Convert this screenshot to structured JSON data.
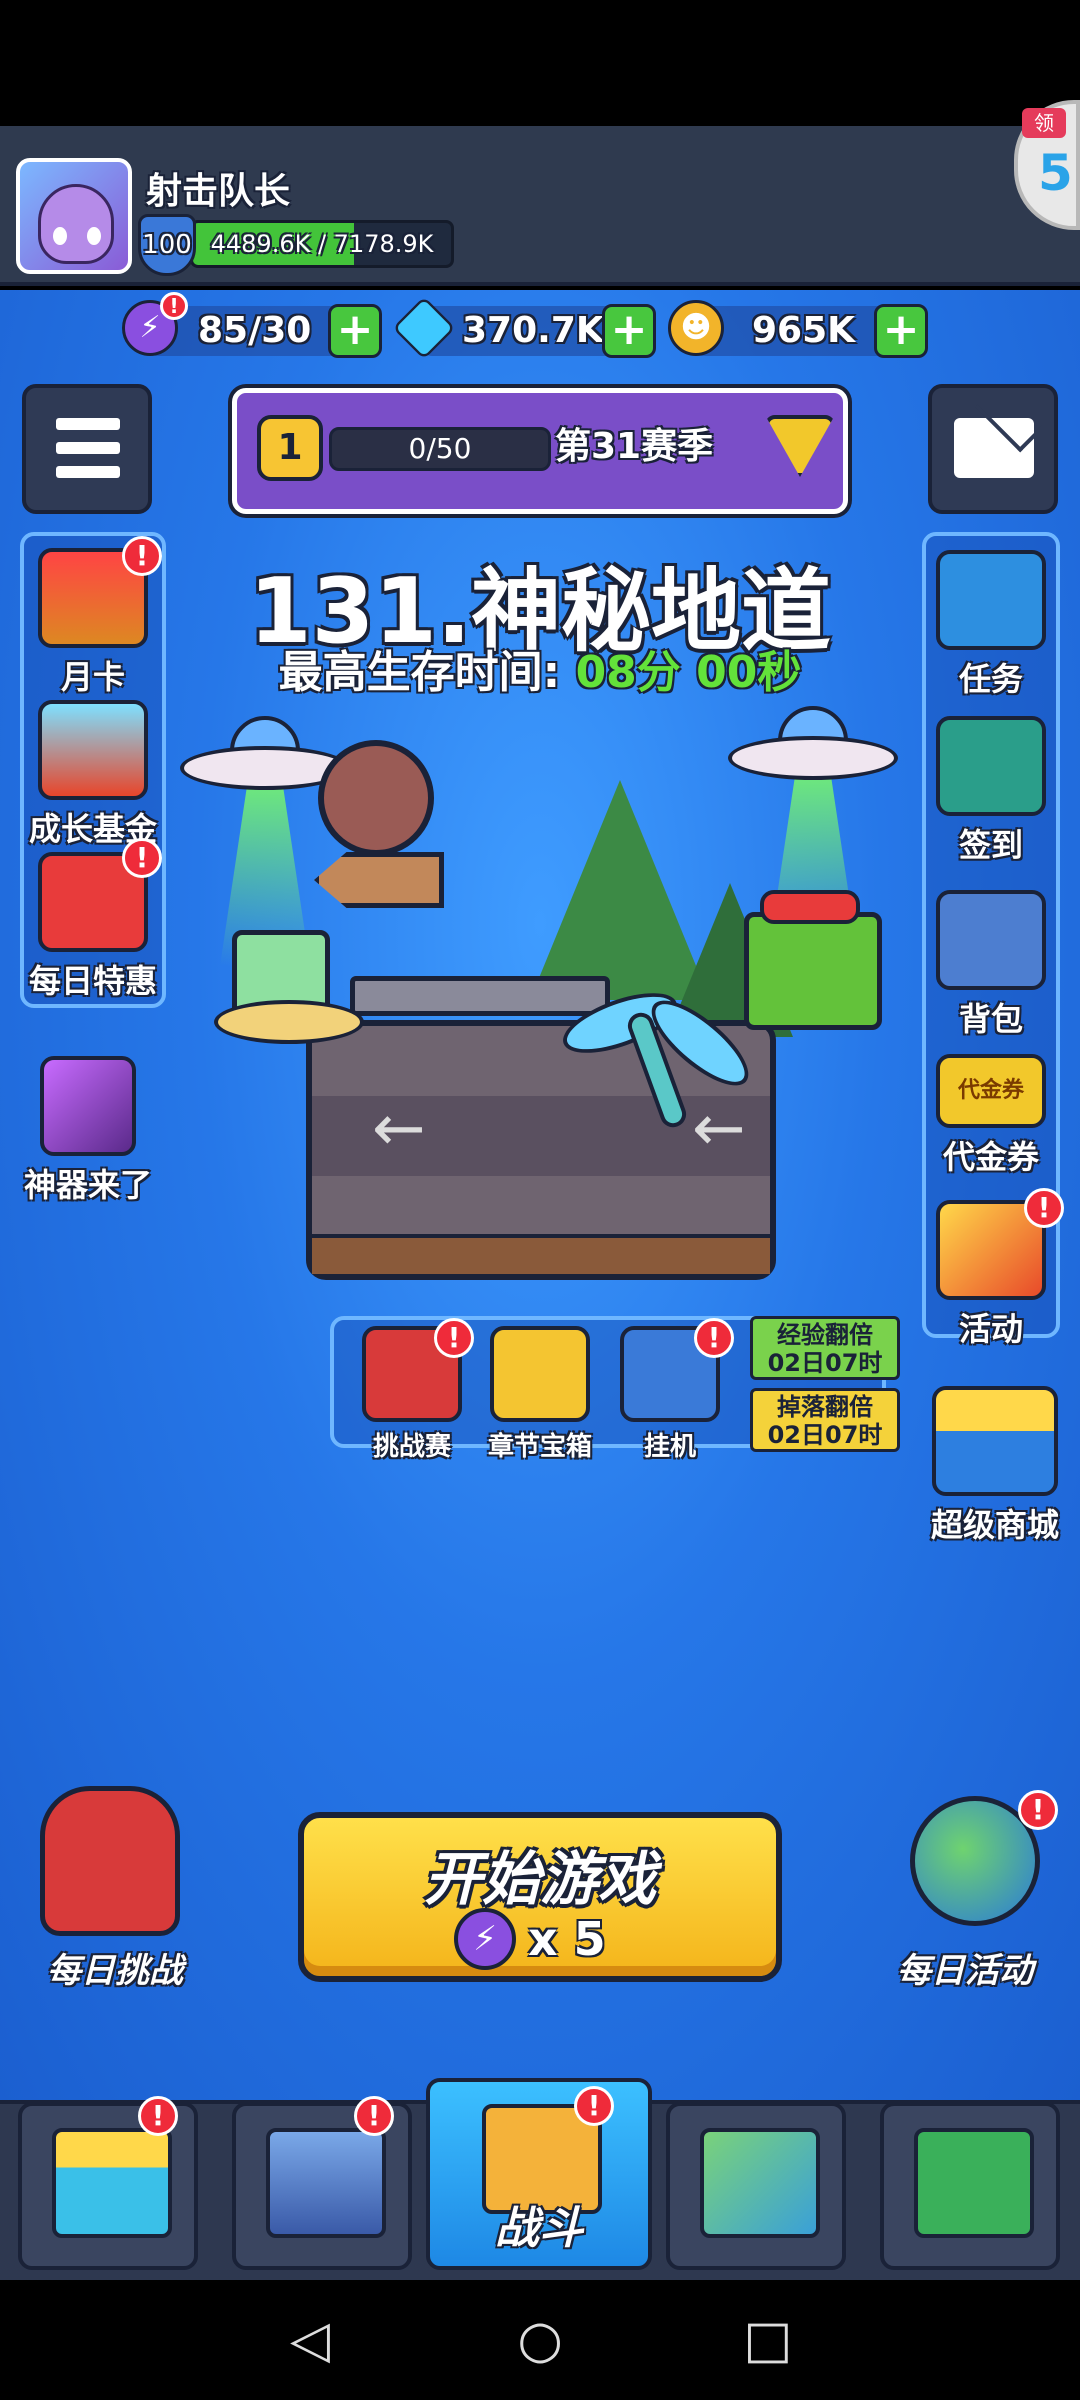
{
  "player": {
    "name": "射击队长",
    "level": "100",
    "xp_text": "4489.6K / 7178.9K",
    "xp_fraction": 0.625
  },
  "reward_badge": {
    "tag": "领",
    "value": "5"
  },
  "currency": {
    "energy": "85/30",
    "gems": "370.7K",
    "coins": "965K"
  },
  "season": {
    "level": "1",
    "progress": "0/50",
    "label": "第31赛季"
  },
  "stage": {
    "title": "131.神秘地道",
    "survive_label": "最高生存时间: ",
    "survive_value": "08分 00秒"
  },
  "left_side": {
    "items": [
      {
        "label": "月卡",
        "icon": "card-crown-icon"
      },
      {
        "label": "成长基金",
        "icon": "gem-basket-icon"
      },
      {
        "label": "每日特惠",
        "icon": "shopping-basket-icon"
      }
    ],
    "artifact": "神器来了"
  },
  "right_side": {
    "items": [
      {
        "label": "任务",
        "icon": "task-book-icon"
      },
      {
        "label": "签到",
        "icon": "signin-tablet-icon"
      },
      {
        "label": "背包",
        "icon": "backpack-icon"
      },
      {
        "label": "代金券",
        "icon": "voucher-icon"
      },
      {
        "label": "活动",
        "icon": "party-horn-icon"
      }
    ],
    "shop": "超级商城",
    "voucher_text": "代金券"
  },
  "mini_bar": {
    "items": [
      {
        "label": "挑战赛",
        "icon": "crossed-swords-icon"
      },
      {
        "label": "章节宝箱",
        "icon": "treasure-chest-icon"
      },
      {
        "label": "挂机",
        "icon": "robot-idle-icon"
      }
    ],
    "boost_exp": {
      "line1": "经验翻倍",
      "line2": "02日07时"
    },
    "boost_drop": {
      "line1": "掉落翻倍",
      "line2": "02日07时"
    }
  },
  "start_button": {
    "label": "开始游戏",
    "cost": "x 5"
  },
  "corners": {
    "left": "每日挑战",
    "right": "每日活动"
  },
  "tabs": [
    {
      "name": "shop-tab",
      "label": ""
    },
    {
      "name": "equipment-tab",
      "label": ""
    },
    {
      "name": "battle-tab",
      "label": "战斗"
    },
    {
      "name": "map-tab",
      "label": ""
    },
    {
      "name": "upgrade-tab",
      "label": ""
    }
  ],
  "alert_mark": "!",
  "colors": {
    "accent_green": "#63e23a",
    "energy_purple": "#8a4fe0",
    "gem_blue": "#3ec9ff",
    "start_yellow": "#ffd83a"
  }
}
